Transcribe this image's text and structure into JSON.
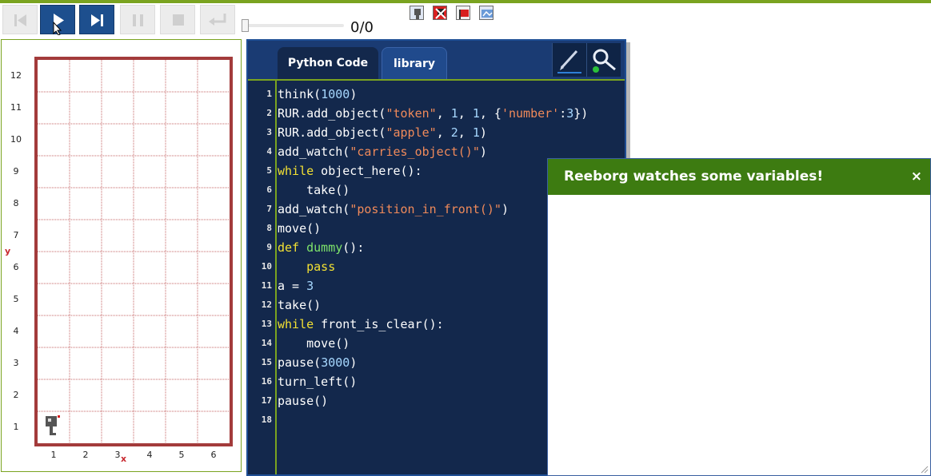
{
  "toolbar": {
    "buttons": [
      {
        "name": "go-to-start-icon"
      },
      {
        "name": "run-icon"
      },
      {
        "name": "step-icon"
      },
      {
        "name": "pause-icon"
      },
      {
        "name": "stop-icon"
      },
      {
        "name": "reload-icon"
      }
    ],
    "step_counter": "0/0",
    "mini_icons": [
      "robot-icon",
      "delete-robot-icon",
      "flag-icon",
      "world-map-icon"
    ]
  },
  "world": {
    "y_ticks": [
      "12",
      "11",
      "10",
      "9",
      "8",
      "7",
      "6",
      "5",
      "4",
      "3",
      "2",
      "1"
    ],
    "x_ticks": [
      "1",
      "2",
      "3",
      "4",
      "5",
      "6"
    ],
    "x_axis_label": "x",
    "y_axis_label": "y",
    "robot": {
      "x": 1,
      "y": 1,
      "icon": "robot-icon"
    }
  },
  "editor": {
    "tabs": [
      "Python Code",
      "library"
    ],
    "tools": [
      "pen-edit-icon",
      "magnifier-icon"
    ],
    "lines": [
      [
        {
          "t": "think("
        },
        {
          "t": "1000",
          "c": "nm"
        },
        {
          "t": ")"
        }
      ],
      [
        {
          "t": "RUR.add_object("
        },
        {
          "t": "\"token\"",
          "c": "st"
        },
        {
          "t": ", "
        },
        {
          "t": "1",
          "c": "nm"
        },
        {
          "t": ", "
        },
        {
          "t": "1",
          "c": "nm"
        },
        {
          "t": ", {"
        },
        {
          "t": "'number'",
          "c": "st"
        },
        {
          "t": ":"
        },
        {
          "t": "3",
          "c": "nm"
        },
        {
          "t": "})"
        }
      ],
      [
        {
          "t": "RUR.add_object("
        },
        {
          "t": "\"apple\"",
          "c": "st"
        },
        {
          "t": ", "
        },
        {
          "t": "2",
          "c": "nm"
        },
        {
          "t": ", "
        },
        {
          "t": "1",
          "c": "nm"
        },
        {
          "t": ")"
        }
      ],
      [
        {
          "t": "add_watch("
        },
        {
          "t": "\"carries_object()\"",
          "c": "st"
        },
        {
          "t": ")"
        }
      ],
      [
        {
          "t": "while",
          "c": "kw"
        },
        {
          "t": " object_here():"
        }
      ],
      [
        {
          "t": "    take()"
        }
      ],
      [
        {
          "t": "add_watch("
        },
        {
          "t": "\"position_in_front()\"",
          "c": "st"
        },
        {
          "t": ")"
        }
      ],
      [
        {
          "t": "move()"
        }
      ],
      [
        {
          "t": "def",
          "c": "kw"
        },
        {
          "t": " "
        },
        {
          "t": "dummy",
          "c": "fn"
        },
        {
          "t": "():"
        }
      ],
      [
        {
          "t": "    "
        },
        {
          "t": "pass",
          "c": "kw"
        }
      ],
      [
        {
          "t": "a = "
        },
        {
          "t": "3",
          "c": "nm"
        }
      ],
      [
        {
          "t": "take()"
        }
      ],
      [
        {
          "t": "while",
          "c": "kw"
        },
        {
          "t": " front_is_clear():"
        }
      ],
      [
        {
          "t": "    move()"
        }
      ],
      [
        {
          "t": "pause("
        },
        {
          "t": "3000",
          "c": "nm"
        },
        {
          "t": ")"
        }
      ],
      [
        {
          "t": "turn_left()"
        }
      ],
      [
        {
          "t": "pause()"
        }
      ],
      []
    ]
  },
  "watch": {
    "title": "Reeborg watches some variables!",
    "close": "×"
  }
}
